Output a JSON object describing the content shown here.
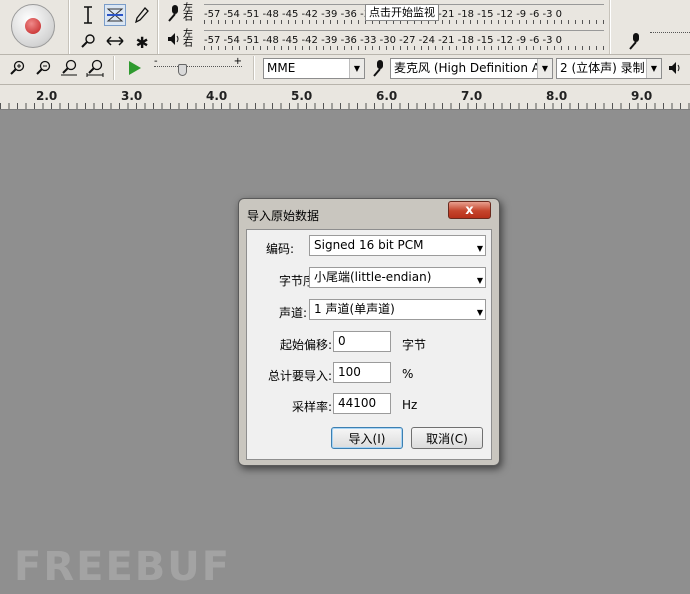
{
  "toolbar": {
    "record_label": "",
    "channel_labels": [
      "左",
      "右"
    ],
    "meter_scale": "-57 -54 -51 -48 -45 -42 -39 -36 -33 -30 -27 -24 -21 -18 -15 -12 -9 -6 -3 0",
    "monitor_tip": "点击开始监视",
    "host": "MME",
    "input_device": "麦克风 (High Definition Au",
    "channels": "2 (立体声) 录制",
    "slider_minus": "-",
    "slider_plus": "+"
  },
  "ruler": {
    "labels": [
      "2.0",
      "3.0",
      "4.0",
      "5.0",
      "6.0",
      "7.0",
      "8.0",
      "9.0"
    ]
  },
  "dialog": {
    "title": "导入原始数据",
    "close_symbol": "x",
    "encoding_label": "编码:",
    "encoding_value": "Signed 16 bit PCM",
    "byte_order_label": "字节序:",
    "byte_order_value": "小尾端(little-endian)",
    "channels_label": "声道:",
    "channels_value": "1 声道(单声道)",
    "offset_label": "起始偏移:",
    "offset_value": "0",
    "offset_unit": "字节",
    "amount_label": "总计要导入:",
    "amount_value": "100",
    "amount_unit": "%",
    "rate_label": "采样率:",
    "rate_value": "44100",
    "rate_unit": "Hz",
    "import_button": "导入(I)",
    "cancel_button": "取消(C)"
  },
  "watermark": "FREEBUF"
}
